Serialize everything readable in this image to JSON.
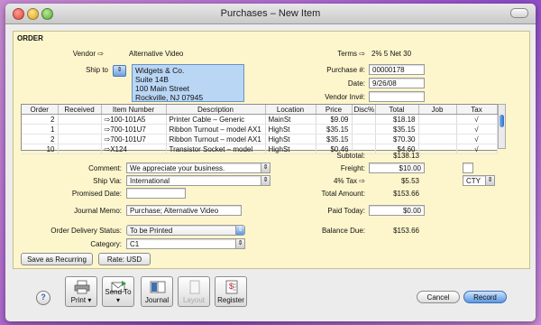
{
  "window": {
    "title": "Purchases – New Item"
  },
  "form": {
    "section_label": "ORDER",
    "vendor_label": "Vendor",
    "vendor": "Alternative Video",
    "terms_label": "Terms",
    "terms": "2% 5 Net 30",
    "ship_to_label": "Ship to",
    "ship_to_lines": [
      "Widgets & Co.",
      "Suite 14B",
      "100 Main Street",
      "Rockville, NJ  07945"
    ],
    "purchase_no_label": "Purchase #:",
    "purchase_no": "00000178",
    "date_label": "Date:",
    "date": "9/26/08",
    "vendor_inv_label": "Vendor Inv#:",
    "vendor_inv": ""
  },
  "table": {
    "headers": [
      "Order",
      "Received",
      "Item Number",
      "Description",
      "Location",
      "Price",
      "Disc%",
      "Total",
      "Job",
      "Tax"
    ],
    "rows": [
      {
        "order": "2",
        "received": "",
        "item": "100-101A5",
        "desc": "Printer Cable – Generic",
        "loc": "MainSt",
        "price": "$9.09",
        "disc": "",
        "total": "$18.18",
        "job": "",
        "tax": "√"
      },
      {
        "order": "1",
        "received": "",
        "item": "700-101U7",
        "desc": "Ribbon Turnout – model AX1",
        "loc": "HighSt",
        "price": "$35.15",
        "disc": "",
        "total": "$35.15",
        "job": "",
        "tax": "√"
      },
      {
        "order": "2",
        "received": "",
        "item": "700-101U7",
        "desc": "Ribbon Turnout – model AX1",
        "loc": "HighSt",
        "price": "$35.15",
        "disc": "",
        "total": "$70.30",
        "job": "",
        "tax": "√"
      },
      {
        "order": "10",
        "received": "",
        "item": "X124",
        "desc": "Transistor Socket – model",
        "loc": "HighSt",
        "price": "$0.46",
        "disc": "",
        "total": "$4.60",
        "job": "",
        "tax": "√"
      }
    ]
  },
  "totals": {
    "subtotal_label": "Subtotal:",
    "subtotal": "$138.13",
    "freight_label": "Freight:",
    "freight": "$10.00",
    "tax_label": "4%  Tax",
    "tax": "$5.53",
    "tax_code": "CTY",
    "total_label": "Total Amount:",
    "total": "$153.66",
    "paid_label": "Paid Today:",
    "paid": "$0.00",
    "balance_label": "Balance Due:",
    "balance": "$153.66"
  },
  "misc": {
    "comment_label": "Comment:",
    "comment": "We appreciate your business.",
    "ship_via_label": "Ship Via:",
    "ship_via": "International",
    "promised_label": "Promised Date:",
    "promised": "",
    "memo_label": "Journal Memo:",
    "memo": "Purchase; Alternative Video",
    "delivery_label": "Order Delivery Status:",
    "delivery": "To be Printed",
    "category_label": "Category:",
    "category": "C1",
    "save_recurring": "Save as Recurring",
    "rate": "Rate:  USD"
  },
  "toolbar": {
    "help": "?",
    "print": "Print",
    "send_to": "Send To",
    "journal": "Journal",
    "layout": "Layout",
    "register": "Register",
    "cancel": "Cancel",
    "record": "Record"
  }
}
